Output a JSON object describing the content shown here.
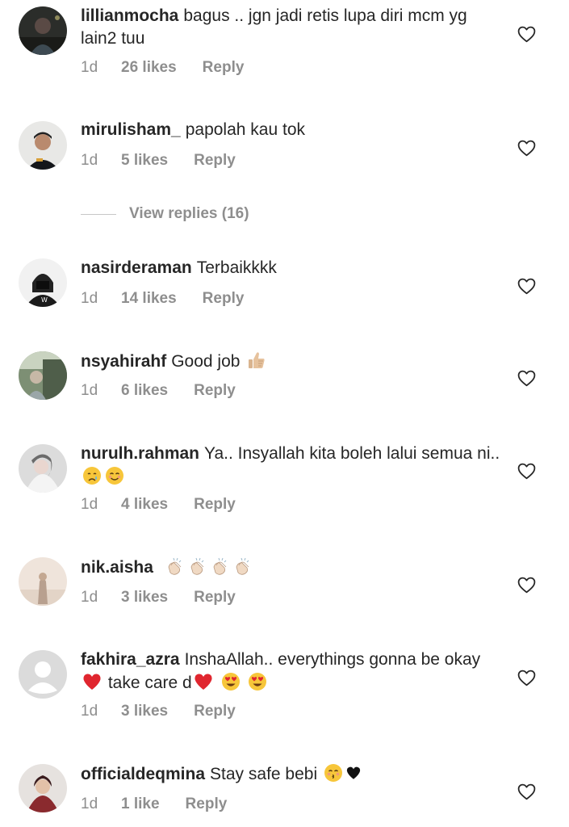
{
  "comments": [
    {
      "username": "lillianmocha",
      "text": "bagus .. jgn jadi retis lupa diri mcm yg lain2 tuu",
      "time": "1d",
      "likes": "26 likes",
      "reply": "Reply"
    },
    {
      "username": "mirulisham_",
      "text": "papolah kau tok",
      "time": "1d",
      "likes": "5 likes",
      "reply": "Reply"
    },
    {
      "username": "nasirderaman",
      "text": "Terbaikkkk",
      "time": "1d",
      "likes": "14 likes",
      "reply": "Reply"
    },
    {
      "username": "nsyahirahf",
      "text": "Good job",
      "emoji": "thumbs-up-emoji",
      "time": "1d",
      "likes": "6 likes",
      "reply": "Reply"
    },
    {
      "username": "nurulh.rahman",
      "text": "Ya.. Insyallah kita boleh lalui semua ni..",
      "emojis": [
        "crying-face-emoji",
        "smiling-face-emoji"
      ],
      "time": "1d",
      "likes": "4 likes",
      "reply": "Reply"
    },
    {
      "username": "nik.aisha",
      "text": "",
      "emojis": [
        "clapping-hands-emoji",
        "clapping-hands-emoji",
        "clapping-hands-emoji",
        "clapping-hands-emoji"
      ],
      "time": "1d",
      "likes": "3 likes",
      "reply": "Reply"
    },
    {
      "username": "fakhira_azra",
      "text_part1": "InshaAllah.. everythings gonna be okay",
      "text_part2": "take care d",
      "emojis": [
        "red-heart-emoji",
        "red-heart-emoji",
        "heart-eyes-emoji",
        "heart-eyes-emoji"
      ],
      "time": "1d",
      "likes": "3 likes",
      "reply": "Reply"
    },
    {
      "username": "officialdeqmina",
      "text": "Stay safe bebi",
      "emojis": [
        "kissing-face-emoji",
        "black-heart-emoji"
      ],
      "time": "1d",
      "likes": "1 like",
      "reply": "Reply"
    }
  ],
  "view_replies": {
    "label": "View replies (16)"
  },
  "colors": {
    "text": "#262626",
    "meta": "#8e8e8e",
    "divider": "#c7c7c7"
  }
}
